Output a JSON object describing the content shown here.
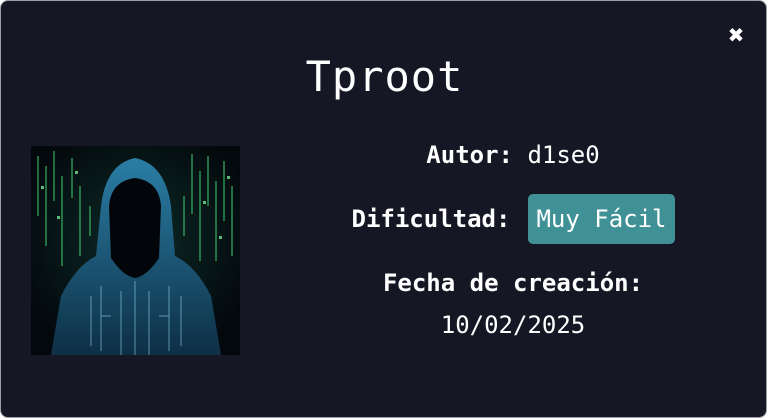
{
  "modal": {
    "title": "Tproot",
    "close_icon": "close-icon"
  },
  "avatar": {
    "icon": "hooded-hacker-image"
  },
  "author": {
    "label": "Autor:",
    "value": "d1se0"
  },
  "difficulty": {
    "label": "Dificultad:",
    "value": "Muy Fácil",
    "badge_color": "#3f9196"
  },
  "created": {
    "label": "Fecha de creación:",
    "value": "10/02/2025"
  },
  "colors": {
    "background": "#161724",
    "text": "#ffffff"
  }
}
